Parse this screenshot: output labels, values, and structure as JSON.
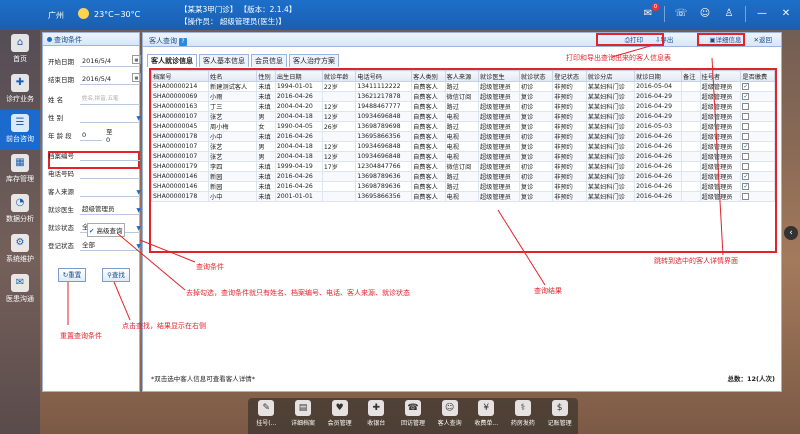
{
  "topbar": {
    "city": "广州",
    "temp": "23°C~30°C",
    "line1": "【某某3甲门诊】  【版本：2.1.4】",
    "line2": "【操作员：  超级管理员(医生)】",
    "badge": "0"
  },
  "nav": [
    {
      "icon": "⌂",
      "label": "首页"
    },
    {
      "icon": "✚",
      "label": "诊疗业务"
    },
    {
      "icon": "☰",
      "label": "前台咨询"
    },
    {
      "icon": "▦",
      "label": "库存管理"
    },
    {
      "icon": "◔",
      "label": "数据分析"
    },
    {
      "icon": "⚙",
      "label": "系统维护"
    },
    {
      "icon": "✉",
      "label": "医患沟通"
    }
  ],
  "query": {
    "title": "查询条件",
    "start_label": "开始日期",
    "start_value": "2016/5/4",
    "end_label": "结束日期",
    "end_value": "2016/5/4",
    "name_label": "姓 名",
    "name_placeholder": "姓名,拼音,五笔",
    "gender_label": "性 别",
    "age_label": "年 龄 段",
    "age_from": "0",
    "age_to_label": "至 0",
    "file_label": "档案编号",
    "phone_label": "电话号码",
    "source_label": "客人来源",
    "doctor_label": "就诊医生",
    "doctor_value": "超级管理员",
    "status_label": "就诊状态",
    "status_value": "全部",
    "reg_label": "登记状态",
    "reg_value": "全部",
    "advanced": "高级查询",
    "reset": "重置",
    "search": "查找"
  },
  "main": {
    "title": "客人查询",
    "print": "打印",
    "export": "导出",
    "detail": "详细信息",
    "back": "返回",
    "tabs": [
      "客人就诊信息",
      "客人基本信息",
      "会员信息",
      "客人治疗方案"
    ],
    "columns": [
      "档案号",
      "姓名",
      "性别",
      "出生日期",
      "就诊年龄",
      "电话号码",
      "客人类别",
      "客人来源",
      "就诊医生",
      "就诊状态",
      "登记状态",
      "就诊分店",
      "就诊日期",
      "备注",
      "挂号者",
      "是否缴费"
    ],
    "rows": [
      [
        "SHA00000214",
        "新建测试客人",
        "未填",
        "1994-01-01",
        "22岁",
        "13411112222",
        "自费客人",
        "路过",
        "超级管理员",
        "初诊",
        "非预约",
        "某某妇科门诊",
        "2016-05-04",
        "",
        "超级管理员",
        "✓"
      ],
      [
        "SHA00000069",
        "小雨",
        "未填",
        "2016-04-26",
        "",
        "13621217878",
        "自费客人",
        "微信订阅",
        "超级管理员",
        "复诊",
        "非预约",
        "某某妇科门诊",
        "2016-04-29",
        "",
        "超级管理员",
        "✓"
      ],
      [
        "SHA00000163",
        "丁三",
        "未填",
        "2004-04-20",
        "12岁",
        "19488467777",
        "自费客人",
        "路过",
        "超级管理员",
        "初诊",
        "非预约",
        "某某妇科门诊",
        "2016-04-29",
        "",
        "超级管理员",
        ""
      ],
      [
        "SHA00000107",
        "张艺",
        "男",
        "2004-04-18",
        "12岁",
        "10934696848",
        "自费客人",
        "电视",
        "超级管理员",
        "复诊",
        "非预约",
        "某某妇科门诊",
        "2016-04-29",
        "",
        "超级管理员",
        ""
      ],
      [
        "SHA00000045",
        "周小梅",
        "女",
        "1990-04-05",
        "26岁",
        "13698789698",
        "自费客人",
        "路过",
        "超级管理员",
        "复诊",
        "非预约",
        "某某妇科门诊",
        "2016-05-03",
        "",
        "超级管理员",
        ""
      ],
      [
        "SHA00000178",
        "小中",
        "未填",
        "2016-04-26",
        "",
        "13695866356",
        "自费客人",
        "电视",
        "超级管理员",
        "初诊",
        "非预约",
        "某某妇科门诊",
        "2016-04-26",
        "",
        "超级管理员",
        ""
      ],
      [
        "SHA00000107",
        "张艺",
        "男",
        "2004-04-18",
        "12岁",
        "10934696848",
        "自费客人",
        "电视",
        "超级管理员",
        "复诊",
        "非预约",
        "某某妇科门诊",
        "2016-04-26",
        "",
        "超级管理员",
        "✓"
      ],
      [
        "SHA00000107",
        "张艺",
        "男",
        "2004-04-18",
        "12岁",
        "10934696848",
        "自费客人",
        "电视",
        "超级管理员",
        "复诊",
        "非预约",
        "某某妇科门诊",
        "2016-04-26",
        "",
        "超级管理员",
        ""
      ],
      [
        "SHA00000179",
        "李四",
        "未填",
        "1999-04-19",
        "17岁",
        "12304847766",
        "自费客人",
        "微信订阅",
        "超级管理员",
        "初诊",
        "非预约",
        "某某妇科门诊",
        "2016-04-26",
        "",
        "超级管理员",
        ""
      ],
      [
        "SHA00000146",
        "新园",
        "未填",
        "2016-04-26",
        "",
        "13698789636",
        "自费客人",
        "路过",
        "超级管理员",
        "初诊",
        "非预约",
        "某某妇科门诊",
        "2016-04-26",
        "",
        "超级管理员",
        "✓"
      ],
      [
        "SHA00000146",
        "新园",
        "未填",
        "2016-04-26",
        "",
        "13698789636",
        "自费客人",
        "路过",
        "超级管理员",
        "复诊",
        "非预约",
        "某某妇科门诊",
        "2016-04-26",
        "",
        "超级管理员",
        "✓"
      ],
      [
        "SHA00000178",
        "小中",
        "未填",
        "2001-01-01",
        "",
        "13695866356",
        "自费客人",
        "电视",
        "超级管理员",
        "复诊",
        "非预约",
        "某某妇科门诊",
        "2016-04-26",
        "",
        "超级管理员",
        ""
      ]
    ],
    "footer": "*双击选中客人信息可查看客人详情*",
    "total": "总数：12(人次)"
  },
  "annotations": {
    "print_note": "打印和导出查询出来的客人信息表",
    "query_cond": "查询条件",
    "uncheck_note": "去掉勾选，查询条件就只有姓名、档案编号、电话、客人来源、就诊状态",
    "result": "查询结果",
    "jump_note": "跳转到选中的客人详情界面",
    "search_note": "点击查找，结果显示在右侧",
    "reset_note": "重置查询条件"
  },
  "taskbar": [
    {
      "icon": "✎",
      "label": "挂号(..."
    },
    {
      "icon": "▤",
      "label": "详细档案"
    },
    {
      "icon": "♥",
      "label": "会员管理"
    },
    {
      "icon": "✚",
      "label": "收银台"
    },
    {
      "icon": "☎",
      "label": "回访管理"
    },
    {
      "icon": "☺",
      "label": "客人查询"
    },
    {
      "icon": "¥",
      "label": "收费单..."
    },
    {
      "icon": "⚕",
      "label": "药房发药"
    },
    {
      "icon": "$",
      "label": "记账管理"
    }
  ]
}
